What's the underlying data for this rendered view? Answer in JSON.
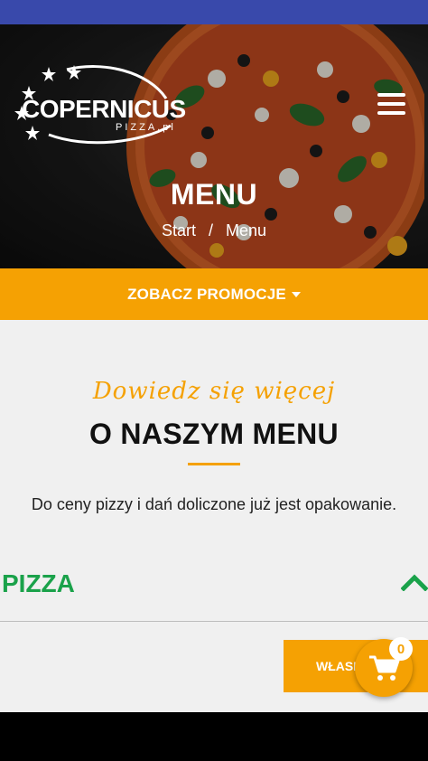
{
  "brand": {
    "name": "COPERNICUS",
    "subtitle": "PIZZA.pl"
  },
  "hero": {
    "title": "MENU",
    "breadcrumb": [
      "Start",
      "/",
      "Menu"
    ]
  },
  "promo": {
    "label": "ZOBACZ PROMOCJE"
  },
  "section": {
    "script_heading": "Dowiedz się więcej",
    "title": "O NASZYM MENU",
    "info": "Do ceny pizzy i dań doliczone już jest opakowanie."
  },
  "category": {
    "label": "PIZZA"
  },
  "own_pizza": {
    "label": "WŁASN"
  },
  "cart": {
    "count": "0"
  },
  "colors": {
    "accent": "#f5a103",
    "green": "#1aa24a",
    "status_bar": "#3949ab"
  },
  "icons": [
    "hamburger-menu-icon",
    "chevron-up-icon",
    "cart-icon",
    "caret-down-icon",
    "star-icon"
  ]
}
